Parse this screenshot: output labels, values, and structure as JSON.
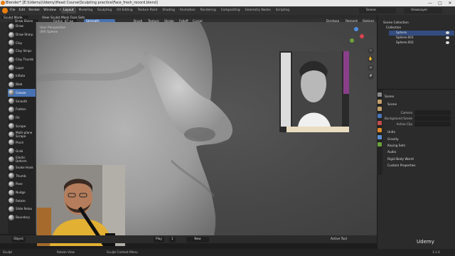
{
  "window": {
    "title": "Blender* [E:\\Udemy\\Udemy\\Head Course\\Sculpting practice\\Face_fresh_record.blend]",
    "controls": [
      "—",
      "□",
      "✕"
    ]
  },
  "menubar": {
    "items": [
      "File",
      "Edit",
      "Render",
      "Window",
      "Help"
    ],
    "workspaces": [
      "Layout",
      "Modeling",
      "Sculpting",
      "UV Editing",
      "Texture Paint",
      "Shading",
      "Animation",
      "Rendering",
      "Compositing",
      "Geometry Nodes",
      "Scripting"
    ],
    "active_workspace": "Layout",
    "scene": "Scene",
    "view_layer": "ViewLayer"
  },
  "viewport_header": {
    "mode": "Sculpt Mode",
    "menus": [
      "View",
      "Sculpt",
      "Mask",
      "Face Sets"
    ],
    "brush": "Draw Sharp",
    "radius_label": "Radius",
    "radius_value": "87 px",
    "strength_label": "Strength",
    "strength_value": "0.500",
    "tool_menus": [
      "Brush",
      "Texture",
      "Stroke",
      "Falloff",
      "Cursor"
    ],
    "dyntopo": "Dyntopo",
    "remesh": "Remesh",
    "options": "Options"
  },
  "viewport_info": {
    "line1": "User Perspective",
    "line2": "(69) Sphere"
  },
  "brushes": [
    {
      "label": "Draw"
    },
    {
      "label": "Draw Sharp"
    },
    {
      "label": "Clay"
    },
    {
      "label": "Clay Strips"
    },
    {
      "label": "Clay Thumb"
    },
    {
      "label": "Layer"
    },
    {
      "label": "Inflate"
    },
    {
      "label": "Blob"
    },
    {
      "label": "Crease"
    },
    {
      "label": "Smooth"
    },
    {
      "label": "Flatten"
    },
    {
      "label": "Fill"
    },
    {
      "label": "Scrape"
    },
    {
      "label": "Multi-plane Scrape"
    },
    {
      "label": "Pinch"
    },
    {
      "label": "Grab"
    },
    {
      "label": "Elastic Deform"
    },
    {
      "label": "Snake Hook"
    },
    {
      "label": "Thumb"
    },
    {
      "label": "Pose"
    },
    {
      "label": "Nudge"
    },
    {
      "label": "Rotate"
    },
    {
      "label": "Slide Relax"
    },
    {
      "label": "Boundary"
    }
  ],
  "selected_brush": "Crease",
  "viewport_footer": {
    "object_mode": "Object",
    "playback": "Play",
    "frame": "1",
    "new": "New",
    "active_tool_panel": "Active Tool"
  },
  "outliner": {
    "title": "Scene Collection",
    "collection": "Collection",
    "objects": [
      "Sphere",
      "Sphere.001",
      "Sphere.002"
    ],
    "selected_object": "Sphere"
  },
  "properties": {
    "header": "Scene",
    "section_scene": "Scene",
    "camera_label": "Camera",
    "background_scene_label": "Background Scene",
    "active_clip_label": "Active Clip",
    "sections": [
      "Units",
      "Gravity",
      "Keying Sets",
      "Audio",
      "Rigid Body World",
      "Custom Properties"
    ]
  },
  "statusbar": {
    "items": [
      "Sculpt",
      "Rotate View",
      "Sculpt Context Menu"
    ],
    "version": "3.1.0"
  },
  "watermark": "Udemy",
  "colors": {
    "accent": "#4772b3",
    "panel": "#2b2b2b",
    "viewport": "#4b4b4b",
    "blender_orange": "#e87d0d"
  }
}
